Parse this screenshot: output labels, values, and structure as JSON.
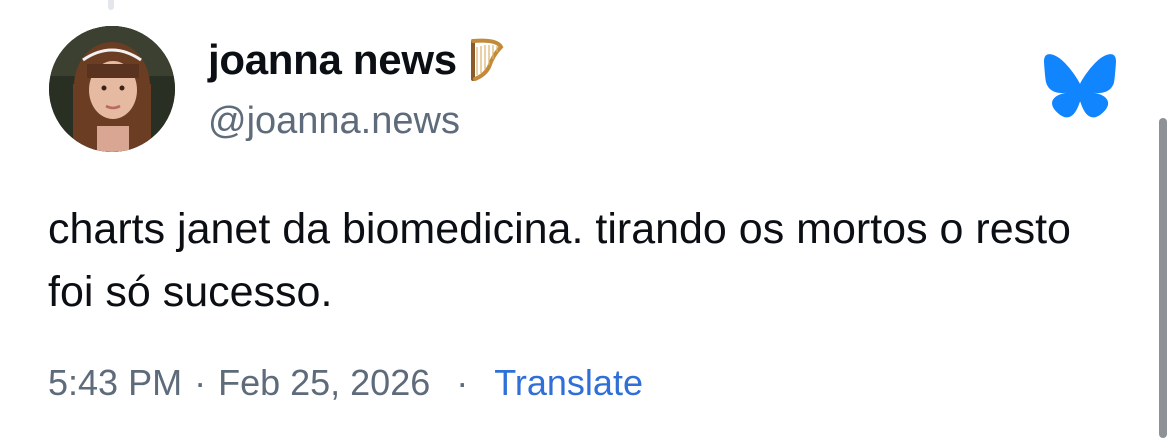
{
  "post": {
    "author": {
      "display_name": "joanna news",
      "name_emoji": "harp-icon",
      "handle": "@joanna.news"
    },
    "text": "charts janet da biomedicina. tirando os mortos o resto foi só sucesso.",
    "timestamp": {
      "time": "5:43 PM",
      "separator": "·",
      "date": "Feb 25, 2026"
    },
    "separator": "·",
    "translate_label": "Translate",
    "platform_icon": "bluesky-butterfly-icon"
  },
  "colors": {
    "text": "#0b0f14",
    "secondary": "#5e6b7a",
    "link": "#2f6fd8",
    "brand": "#1185fe"
  }
}
